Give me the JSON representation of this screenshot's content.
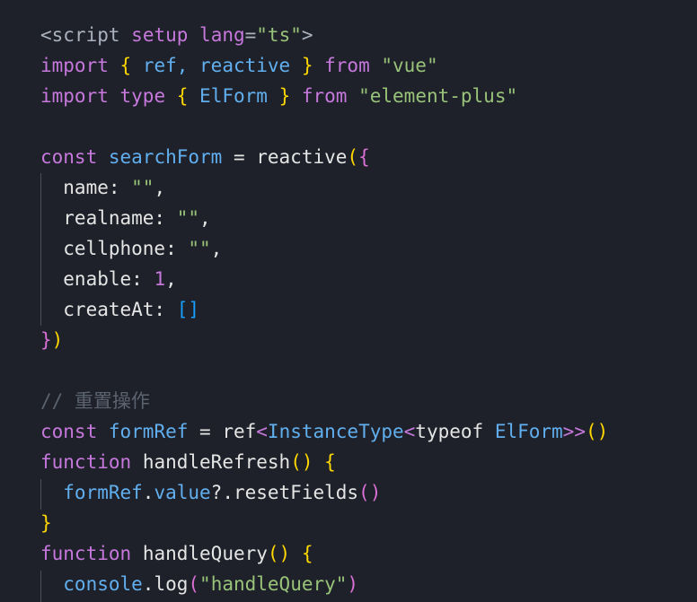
{
  "theme": {
    "background": "#1e2129",
    "keyword": "#c678dd",
    "string": "#98c379",
    "identifier": "#61afef",
    "comment": "#5c6370",
    "bracket_level_1": "#ffd700",
    "bracket_level_2": "#da70d6",
    "bracket_level_3": "#179fff"
  },
  "code": [
    [
      {
        "t": "<",
        "c": "tag"
      },
      {
        "t": "script",
        "c": "tag"
      },
      {
        "t": " ",
        "c": "tag"
      },
      {
        "t": "setup",
        "c": "attr"
      },
      {
        "t": " ",
        "c": "tag"
      },
      {
        "t": "lang",
        "c": "attr"
      },
      {
        "t": "=",
        "c": "tag"
      },
      {
        "t": "\"ts\"",
        "c": "str"
      },
      {
        "t": ">",
        "c": "tag"
      }
    ],
    [
      {
        "t": "import",
        "c": "kw"
      },
      {
        "t": " ",
        "c": "id"
      },
      {
        "t": "{",
        "c": "b1"
      },
      {
        "t": " ref, reactive ",
        "c": "var"
      },
      {
        "t": "}",
        "c": "b1"
      },
      {
        "t": " ",
        "c": "id"
      },
      {
        "t": "from",
        "c": "kw"
      },
      {
        "t": " ",
        "c": "id"
      },
      {
        "t": "\"vue\"",
        "c": "str"
      }
    ],
    [
      {
        "t": "import",
        "c": "kw"
      },
      {
        "t": " ",
        "c": "id"
      },
      {
        "t": "type",
        "c": "kw"
      },
      {
        "t": " ",
        "c": "id"
      },
      {
        "t": "{",
        "c": "b1"
      },
      {
        "t": " ElForm ",
        "c": "var"
      },
      {
        "t": "}",
        "c": "b1"
      },
      {
        "t": " ",
        "c": "id"
      },
      {
        "t": "from",
        "c": "kw"
      },
      {
        "t": " ",
        "c": "id"
      },
      {
        "t": "\"element-plus\"",
        "c": "str"
      }
    ],
    [],
    [
      {
        "t": "const",
        "c": "kw"
      },
      {
        "t": " ",
        "c": "id"
      },
      {
        "t": "searchForm",
        "c": "var"
      },
      {
        "t": " = ",
        "c": "fn"
      },
      {
        "t": "reactive",
        "c": "fn"
      },
      {
        "t": "(",
        "c": "b1"
      },
      {
        "t": "{",
        "c": "b2"
      }
    ],
    [
      {
        "t": "  name: ",
        "c": "fn"
      },
      {
        "t": "\"\"",
        "c": "str"
      },
      {
        "t": ",",
        "c": "fn"
      }
    ],
    [
      {
        "t": "  realname: ",
        "c": "fn"
      },
      {
        "t": "\"\"",
        "c": "str"
      },
      {
        "t": ",",
        "c": "fn"
      }
    ],
    [
      {
        "t": "  cellphone: ",
        "c": "fn"
      },
      {
        "t": "\"\"",
        "c": "str"
      },
      {
        "t": ",",
        "c": "fn"
      }
    ],
    [
      {
        "t": "  enable: ",
        "c": "fn"
      },
      {
        "t": "1",
        "c": "num"
      },
      {
        "t": ",",
        "c": "fn"
      }
    ],
    [
      {
        "t": "  createAt: ",
        "c": "fn"
      },
      {
        "t": "[]",
        "c": "b3"
      }
    ],
    [
      {
        "t": "}",
        "c": "b2"
      },
      {
        "t": ")",
        "c": "b1"
      }
    ],
    [],
    [
      {
        "t": "// 重置操作",
        "c": "cmt"
      }
    ],
    [
      {
        "t": "const",
        "c": "kw"
      },
      {
        "t": " ",
        "c": "id"
      },
      {
        "t": "formRef",
        "c": "var"
      },
      {
        "t": " = ",
        "c": "fn"
      },
      {
        "t": "ref",
        "c": "fn"
      },
      {
        "t": "<",
        "c": "gen"
      },
      {
        "t": "InstanceType",
        "c": "cls"
      },
      {
        "t": "<",
        "c": "gen"
      },
      {
        "t": "typeof",
        "c": "fn"
      },
      {
        "t": " ",
        "c": "fn"
      },
      {
        "t": "ElForm",
        "c": "cls"
      },
      {
        "t": ">>",
        "c": "gen"
      },
      {
        "t": "()",
        "c": "b1"
      }
    ],
    [
      {
        "t": "function",
        "c": "kw"
      },
      {
        "t": " ",
        "c": "fn"
      },
      {
        "t": "handleRefresh",
        "c": "fn"
      },
      {
        "t": "()",
        "c": "b1"
      },
      {
        "t": " ",
        "c": "fn"
      },
      {
        "t": "{",
        "c": "b1"
      }
    ],
    [
      {
        "t": "  formRef",
        "c": "var"
      },
      {
        "t": ".",
        "c": "fn"
      },
      {
        "t": "value",
        "c": "var"
      },
      {
        "t": "?.",
        "c": "fn"
      },
      {
        "t": "resetFields",
        "c": "fn"
      },
      {
        "t": "()",
        "c": "b2"
      }
    ],
    [
      {
        "t": "}",
        "c": "b1"
      }
    ],
    [
      {
        "t": "function",
        "c": "kw"
      },
      {
        "t": " ",
        "c": "fn"
      },
      {
        "t": "handleQuery",
        "c": "fn"
      },
      {
        "t": "()",
        "c": "b1"
      },
      {
        "t": " ",
        "c": "fn"
      },
      {
        "t": "{",
        "c": "b1"
      }
    ],
    [
      {
        "t": "  console",
        "c": "var"
      },
      {
        "t": ".",
        "c": "fn"
      },
      {
        "t": "log",
        "c": "fn"
      },
      {
        "t": "(",
        "c": "b2"
      },
      {
        "t": "\"handleQuery\"",
        "c": "str"
      },
      {
        "t": ")",
        "c": "b2"
      }
    ]
  ]
}
